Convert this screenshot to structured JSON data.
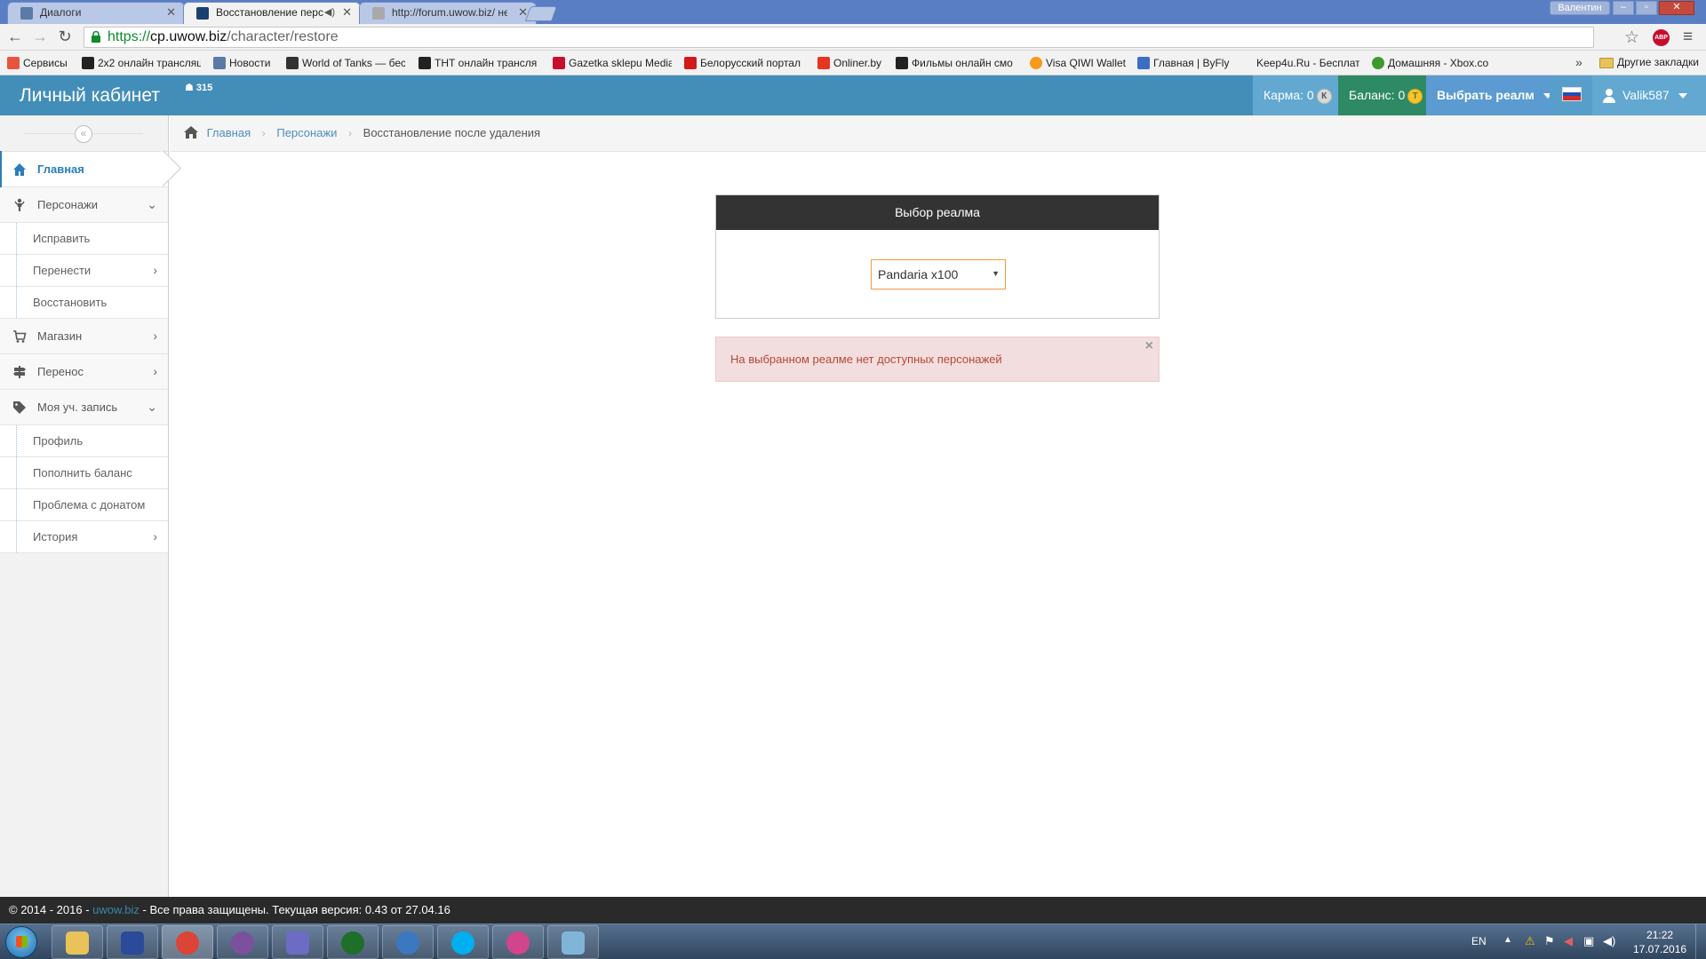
{
  "browser": {
    "tabs": [
      {
        "title": "Диалоги",
        "icon": "vk-dialogs-icon",
        "color": "#5b7aa8"
      },
      {
        "title": "Восстановление перс",
        "icon": "uwow-icon",
        "color": "#1c3f72"
      },
      {
        "title": "http://forum.uwow.biz/ не",
        "icon": "page-icon",
        "color": "#a9a9a9"
      }
    ],
    "window_user": "Валентин",
    "address": {
      "scheme": "https://",
      "host": "cp.uwow.biz",
      "path": "/character/restore"
    },
    "bookmarks": [
      {
        "label": "Сервисы",
        "icon": "apps-grid-icon",
        "color": "#e8553e"
      },
      {
        "label": "2x2 онлайн трансляц",
        "icon": "alien-icon",
        "color": "#222222"
      },
      {
        "label": "Новости",
        "icon": "vk-icon",
        "color": "#5b7aa8"
      },
      {
        "label": "World of Tanks — бес",
        "icon": "wot-icon",
        "color": "#333333"
      },
      {
        "label": "ТНТ онлайн трансляц",
        "icon": "alien-icon",
        "color": "#222222"
      },
      {
        "label": "Gazetka sklepu Media",
        "icon": "gazetka-icon",
        "color": "#c8102e"
      },
      {
        "label": "Белорусский портал",
        "icon": "tut-icon",
        "color": "#d21a1a"
      },
      {
        "label": "Onliner.by",
        "icon": "onliner-icon",
        "color": "#e8351f"
      },
      {
        "label": "Фильмы онлайн смо",
        "icon": "film-icon",
        "color": "#222222"
      },
      {
        "label": "Visa QIWI Wallet",
        "icon": "qiwi-icon",
        "color": "#f59a1c"
      },
      {
        "label": "Главная | ByFly",
        "icon": "byfly-icon",
        "color": "#3a6fc4"
      },
      {
        "label": "Keep4u.Ru - Бесплат",
        "icon": "keep4u-icon",
        "color": "#f2f2f2"
      },
      {
        "label": "Домашняя - Xbox.co",
        "icon": "xbox-icon",
        "color": "#3c9a2f"
      }
    ],
    "bookmarks_more": "»",
    "other_bookmarks": "Другие закладки"
  },
  "header": {
    "brand": "Личный кабинет",
    "notification_count": "315",
    "karma_label": "Карма: 0",
    "karma_coin": "К",
    "balance_label": "Баланс: 0",
    "balance_coin": "Т",
    "realm_button": "Выбрать реалм",
    "username": "Valik587",
    "flag_colors": [
      "#ffffff",
      "#1d4fb8",
      "#d42a2a"
    ]
  },
  "sidebar": {
    "collapse_glyph": "«",
    "items": [
      {
        "label": "Главная",
        "icon": "home-icon"
      },
      {
        "label": "Персонажи",
        "icon": "character-icon",
        "sub": [
          "Исправить",
          "Перенести",
          "Восстановить"
        ]
      },
      {
        "label": "Магазин",
        "icon": "cart-icon"
      },
      {
        "label": "Перенос",
        "icon": "signpost-icon"
      },
      {
        "label": "Моя уч. запись",
        "icon": "tag-icon",
        "sub": [
          "Профиль",
          "Пополнить баланс",
          "Проблема с донатом",
          "История"
        ]
      }
    ]
  },
  "breadcrumb": {
    "home": "Главная",
    "section": "Персонажи",
    "current": "Восстановление после удаления"
  },
  "realm_widget": {
    "title": "Выбор реалма",
    "selected": "Pandaria x100"
  },
  "alert": {
    "message": "На выбранном реалме нет доступных персонажей",
    "close": "×"
  },
  "footer": {
    "prefix": "© 2014 - 2016 - ",
    "link": "uwow.biz",
    "suffix": " - Все права защищены. Текущая версия: 0.43 от 27.04.16"
  },
  "taskbar": {
    "apps": [
      {
        "icon": "explorer-folder-icon",
        "color": "#e9c25a"
      },
      {
        "icon": "save-disk-icon",
        "color": "#2c4a9a"
      },
      {
        "icon": "chrome-icon",
        "color": "#db4437"
      },
      {
        "icon": "viber-icon",
        "color": "#7b519d"
      },
      {
        "icon": "mail-agent-icon",
        "color": "#6c6cc4"
      },
      {
        "icon": "teamspeak-icon",
        "color": "#1d6f2a"
      },
      {
        "icon": "battle-client-icon",
        "color": "#3a78c0"
      },
      {
        "icon": "skype-icon",
        "color": "#00aff0"
      },
      {
        "icon": "itunes-icon",
        "color": "#d0458b"
      },
      {
        "icon": "notes-app-icon",
        "color": "#7fb6d8"
      }
    ],
    "lang": "EN",
    "time": "21:22",
    "date": "17.07.2016"
  }
}
